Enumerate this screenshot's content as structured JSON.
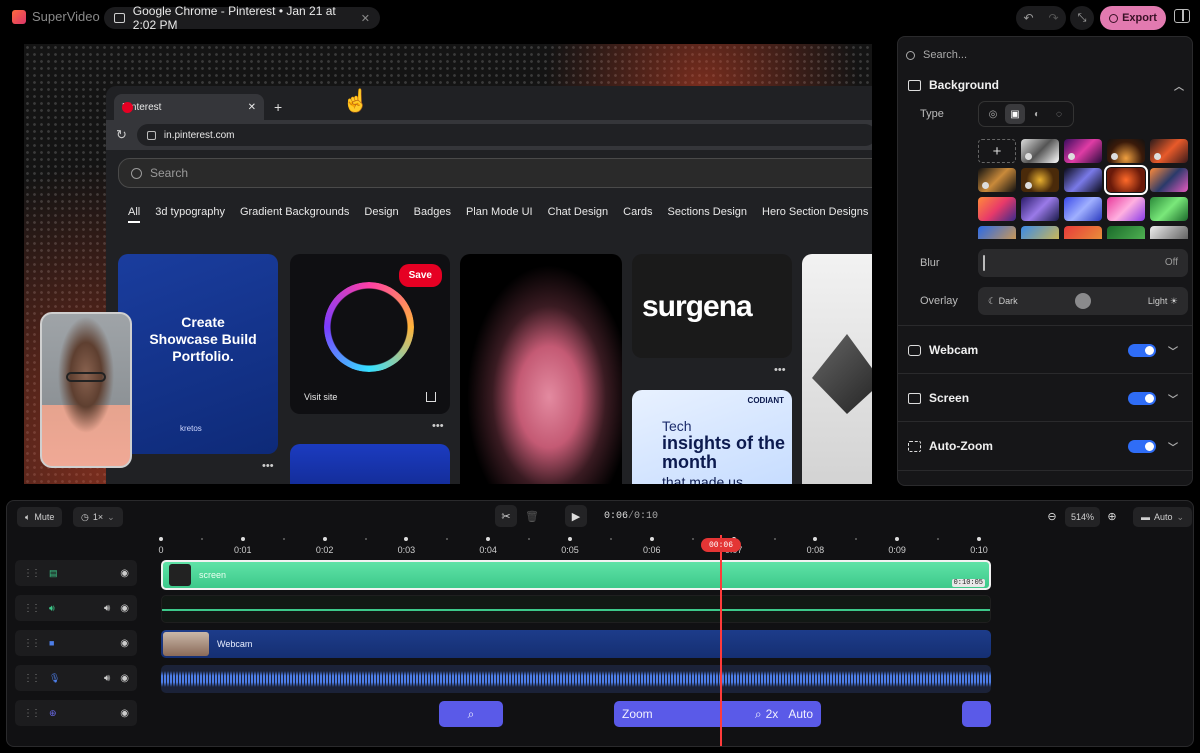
{
  "app": {
    "name": "SuperVideo"
  },
  "topbar": {
    "recording_title": "Google Chrome - Pinterest • Jan 21 at 2:02 PM",
    "close_glyph": "✕",
    "export_label": "Export"
  },
  "preview": {
    "browser_tab_title": "Pinterest",
    "url": "in.pinterest.com",
    "search_placeholder": "Search",
    "categories": [
      "All",
      "3d typography",
      "Gradient Backgrounds",
      "Design",
      "Badges",
      "Plan Mode UI",
      "Chat Design",
      "Cards",
      "Sections Design",
      "Hero Section Designs"
    ],
    "pin1_text": "Create Showcase Build Portfolio.",
    "pin1_brand": "kretos",
    "save_label": "Save",
    "visit_label": "Visit site",
    "pin4_logo": "surgena",
    "pin5_line1": "Tech",
    "pin5_line2": "insights of the month",
    "pin5_line3": "that made us",
    "pin5_badge": "CODIANT",
    "more_glyph": "•••"
  },
  "panel": {
    "search_placeholder": "Search...",
    "background": {
      "title": "Background",
      "type_label": "Type",
      "blur_label": "Blur",
      "blur_value": "Off",
      "overlay_label": "Overlay",
      "overlay_dark": "Dark",
      "overlay_light": "Light",
      "overlay_level": 0.5
    },
    "webcam": {
      "title": "Webcam",
      "enabled": true
    },
    "screen": {
      "title": "Screen",
      "enabled": true
    },
    "autozoom": {
      "title": "Auto-Zoom",
      "enabled": true
    }
  },
  "timeline": {
    "mute_label": "Mute",
    "speed_label": "1×",
    "current_time": "0:06",
    "time_separator": "/",
    "total_time": "0:10",
    "zoom_percent": "514%",
    "auto_label": "Auto",
    "ticks": [
      "0",
      "0:01",
      "0:02",
      "0:03",
      "0:04",
      "0:05",
      "0:06",
      "0:07",
      "0:08",
      "0:09",
      "0:10"
    ],
    "playhead_label": "00:06",
    "screen_clip_name": "screen",
    "screen_clip_duration": "0:10:05",
    "webcam_clip_name": "Webcam",
    "zoom_clip_label": "Zoom",
    "zoom_clip_factor": "2x",
    "zoom_clip_mode": "Auto"
  }
}
